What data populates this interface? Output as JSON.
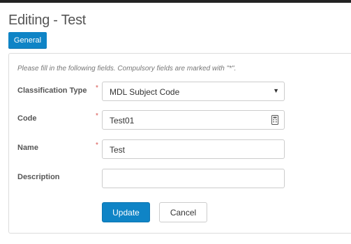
{
  "header": {
    "title": "Editing - Test"
  },
  "tabs": [
    {
      "label": "General"
    }
  ],
  "form": {
    "intro": "Please fill in the following fields. Compulsory fields are marked with \"*\".",
    "required_marker": "*",
    "fields": {
      "classification_type": {
        "label": "Classification Type",
        "value": "MDL Subject Code",
        "required": true
      },
      "code": {
        "label": "Code",
        "value": "Test01",
        "required": true
      },
      "name": {
        "label": "Name",
        "value": "Test",
        "required": true
      },
      "description": {
        "label": "Description",
        "value": "",
        "required": false
      }
    },
    "buttons": {
      "update": "Update",
      "cancel": "Cancel"
    }
  },
  "colors": {
    "accent": "#0f84c6",
    "required": "#d9534f",
    "border": "#cccccc"
  },
  "icons": {
    "select_arrow": "chevron-down-icon",
    "code_field": "keypad-icon"
  }
}
